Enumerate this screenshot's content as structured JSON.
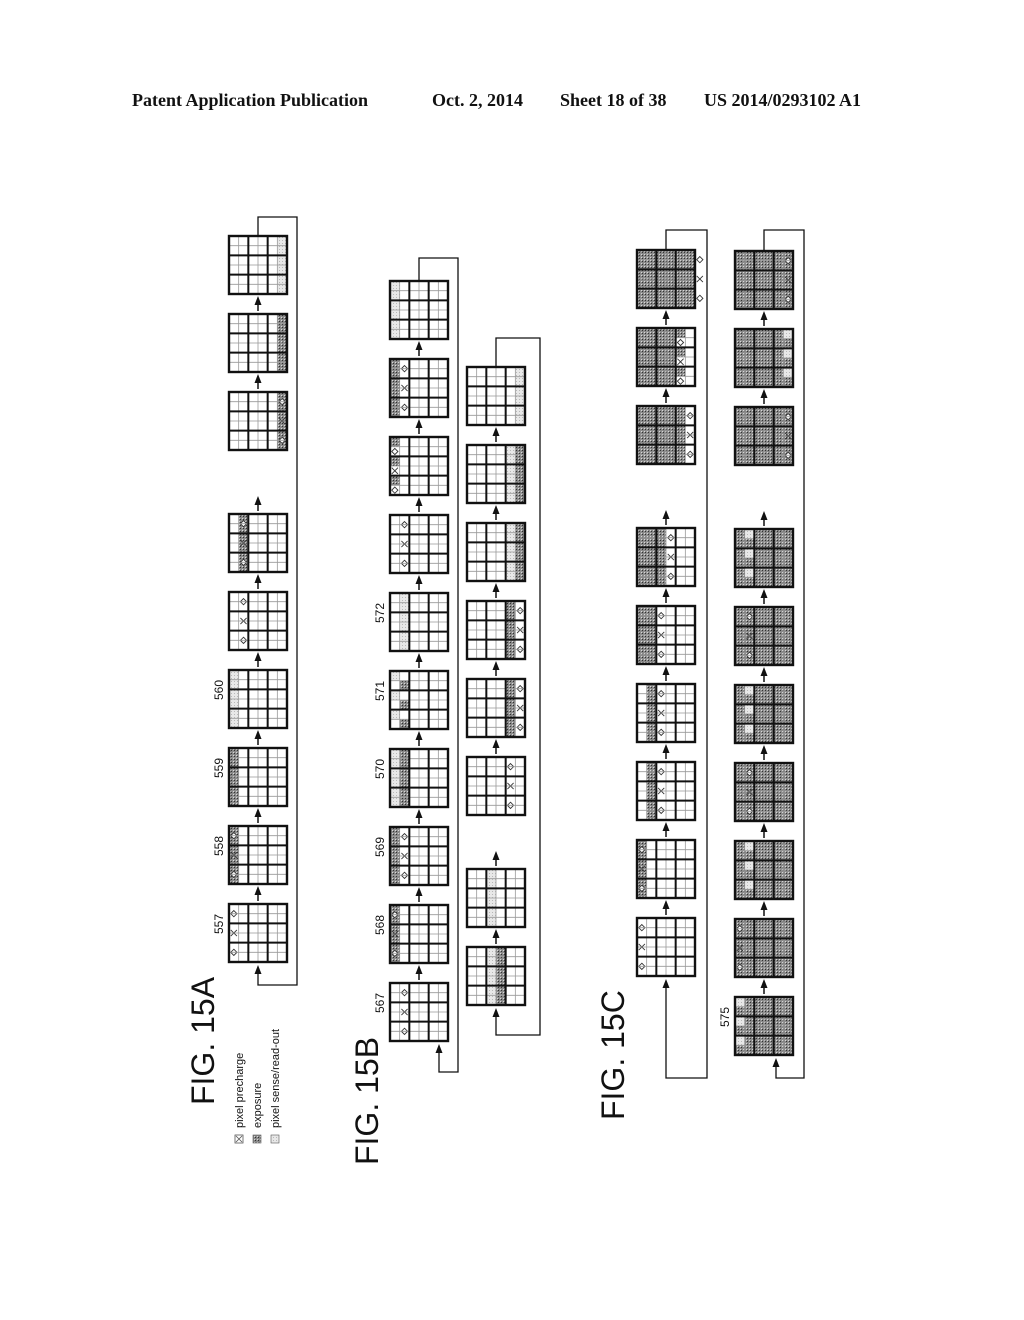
{
  "header": {
    "publication": "Patent Application Publication",
    "date": "Oct. 2, 2014",
    "sheet": "Sheet 18 of 38",
    "number": "US 2014/0293102 A1"
  },
  "legend": {
    "items": [
      {
        "symbol": "precharge",
        "label": "pixel precharge"
      },
      {
        "symbol": "exposure",
        "label": "exposure"
      },
      {
        "symbol": "sense",
        "label": "pixel sense/read-out"
      }
    ]
  },
  "figures": [
    {
      "id": "15A",
      "label": "FIG. 15A",
      "chains": [
        {
          "blocks": [
            {
              "ref": "557",
              "col": 0,
              "sub": 0,
              "state": "P"
            },
            {
              "ref": "558",
              "col": 0,
              "sub": 0,
              "state": "PE"
            },
            {
              "ref": "559",
              "col": 0,
              "sub": 0,
              "state": "E"
            },
            {
              "ref": "560",
              "col": 0,
              "sub": 0,
              "state": "S"
            },
            {
              "ref": "",
              "col": 0,
              "sub": 1,
              "state": "P"
            },
            {
              "ref": "",
              "col": 0,
              "sub": 1,
              "state": "PE"
            },
            {
              "ellipsis": true
            },
            {
              "ref": "",
              "col": 2,
              "sub": 1,
              "state": "PE"
            },
            {
              "ref": "",
              "col": 2,
              "sub": 1,
              "state": "E"
            },
            {
              "ref": "",
              "col": 2,
              "sub": 1,
              "state": "S"
            }
          ]
        }
      ]
    },
    {
      "id": "15B",
      "label": "FIG. 15B",
      "chains": [
        {
          "blocks": [
            {
              "ref": "567",
              "col": 0,
              "sub": 1,
              "state": "P"
            },
            {
              "ref": "568",
              "col": 0,
              "sub": 0,
              "state": "PE"
            },
            {
              "ref": "569",
              "col": 0,
              "sub": 0,
              "state": "EP"
            },
            {
              "ref": "570",
              "col": 0,
              "sub": 0,
              "state": "SE"
            },
            {
              "ref": "571",
              "col": 0,
              "sub": 0,
              "state": "S2E"
            },
            {
              "ref": "572",
              "col": 0,
              "sub": 1,
              "state": "S"
            },
            {
              "ref": "",
              "col": 0,
              "sub": 1,
              "state": "P"
            },
            {
              "ref": "",
              "col": 0,
              "sub": 0,
              "state": "EP2"
            },
            {
              "ref": "",
              "col": 0,
              "sub": 0,
              "state": "EPE"
            },
            {
              "ref": "",
              "col": 0,
              "sub": 0,
              "state": "SE2"
            }
          ]
        },
        {
          "blocks": [
            {
              "ref": "",
              "col": 1,
              "sub": 0,
              "state": "ES"
            },
            {
              "ref": "",
              "col": 1,
              "sub": 0,
              "state": "S"
            },
            {
              "ellipsis": true
            },
            {
              "ref": "",
              "col": 2,
              "sub": 0,
              "state": "P"
            },
            {
              "ref": "",
              "col": 2,
              "sub": 0,
              "state": "EP"
            },
            {
              "ref": "",
              "col": 2,
              "sub": 0,
              "state": "EPE"
            },
            {
              "ref": "",
              "col": 2,
              "sub": 0,
              "state": "SE"
            },
            {
              "ref": "",
              "col": 2,
              "sub": 0,
              "state": "ES"
            },
            {
              "ref": "",
              "col": 2,
              "sub": 1,
              "state": "S"
            }
          ]
        }
      ]
    },
    {
      "id": "15C",
      "label": "FIG. 15C",
      "chains": [
        {
          "blocks": [
            {
              "ref": "",
              "col": 0,
              "sub": 0,
              "state": "P",
              "bg": false,
              "filled_cols": 0
            },
            {
              "ref": "",
              "col": 0,
              "sub": 0,
              "state": "PE",
              "bg": false,
              "filled_cols": 0
            },
            {
              "ref": "",
              "col": 0,
              "sub": 1,
              "state": "EP",
              "bg": false,
              "filled_cols": 0
            },
            {
              "ref": "",
              "col": 0,
              "sub": 1,
              "state": "EP",
              "bg": false,
              "filled_cols": 0
            },
            {
              "ref": "",
              "col": 1,
              "sub": 0,
              "state": "P",
              "bg": false,
              "filled_cols": 1
            },
            {
              "ref": "",
              "col": 1,
              "sub": 0,
              "state": "EP",
              "bg": false,
              "filled_cols": 1
            },
            {
              "ellipsis": true
            },
            {
              "ref": "",
              "col": 2,
              "sub": 0,
              "state": "EP",
              "bg": false,
              "filled_cols": 2
            },
            {
              "ref": "",
              "col": 2,
              "sub": 0,
              "state": "EP2",
              "bg": false,
              "filled_cols": 2
            },
            {
              "ref": "",
              "col": 2,
              "sub": 1,
              "state": "EP",
              "bg": false,
              "filled_cols": 3
            }
          ]
        },
        {
          "blocks": [
            {
              "ref": "575",
              "col": 0,
              "sub": 0,
              "state": "S",
              "bg": true
            },
            {
              "ref": "",
              "col": 0,
              "sub": 0,
              "state": "P",
              "bg": true
            },
            {
              "ref": "",
              "col": 0,
              "sub": 1,
              "state": "S",
              "bg": true
            },
            {
              "ref": "",
              "col": 0,
              "sub": 1,
              "state": "P",
              "bg": true
            },
            {
              "ref": "",
              "col": 0,
              "sub": 1,
              "state": "S",
              "bg": true
            },
            {
              "ref": "",
              "col": 0,
              "sub": 1,
              "state": "P",
              "bg": true
            },
            {
              "ref": "",
              "col": 0,
              "sub": 1,
              "state": "S",
              "bg": true
            },
            {
              "ellipsis": true
            },
            {
              "ref": "",
              "col": 2,
              "sub": 1,
              "state": "P",
              "bg": true
            },
            {
              "ref": "",
              "col": 2,
              "sub": 1,
              "state": "S",
              "bg": true
            },
            {
              "ref": "",
              "col": 2,
              "sub": 1,
              "state": "P",
              "bg": true
            }
          ]
        }
      ]
    }
  ]
}
